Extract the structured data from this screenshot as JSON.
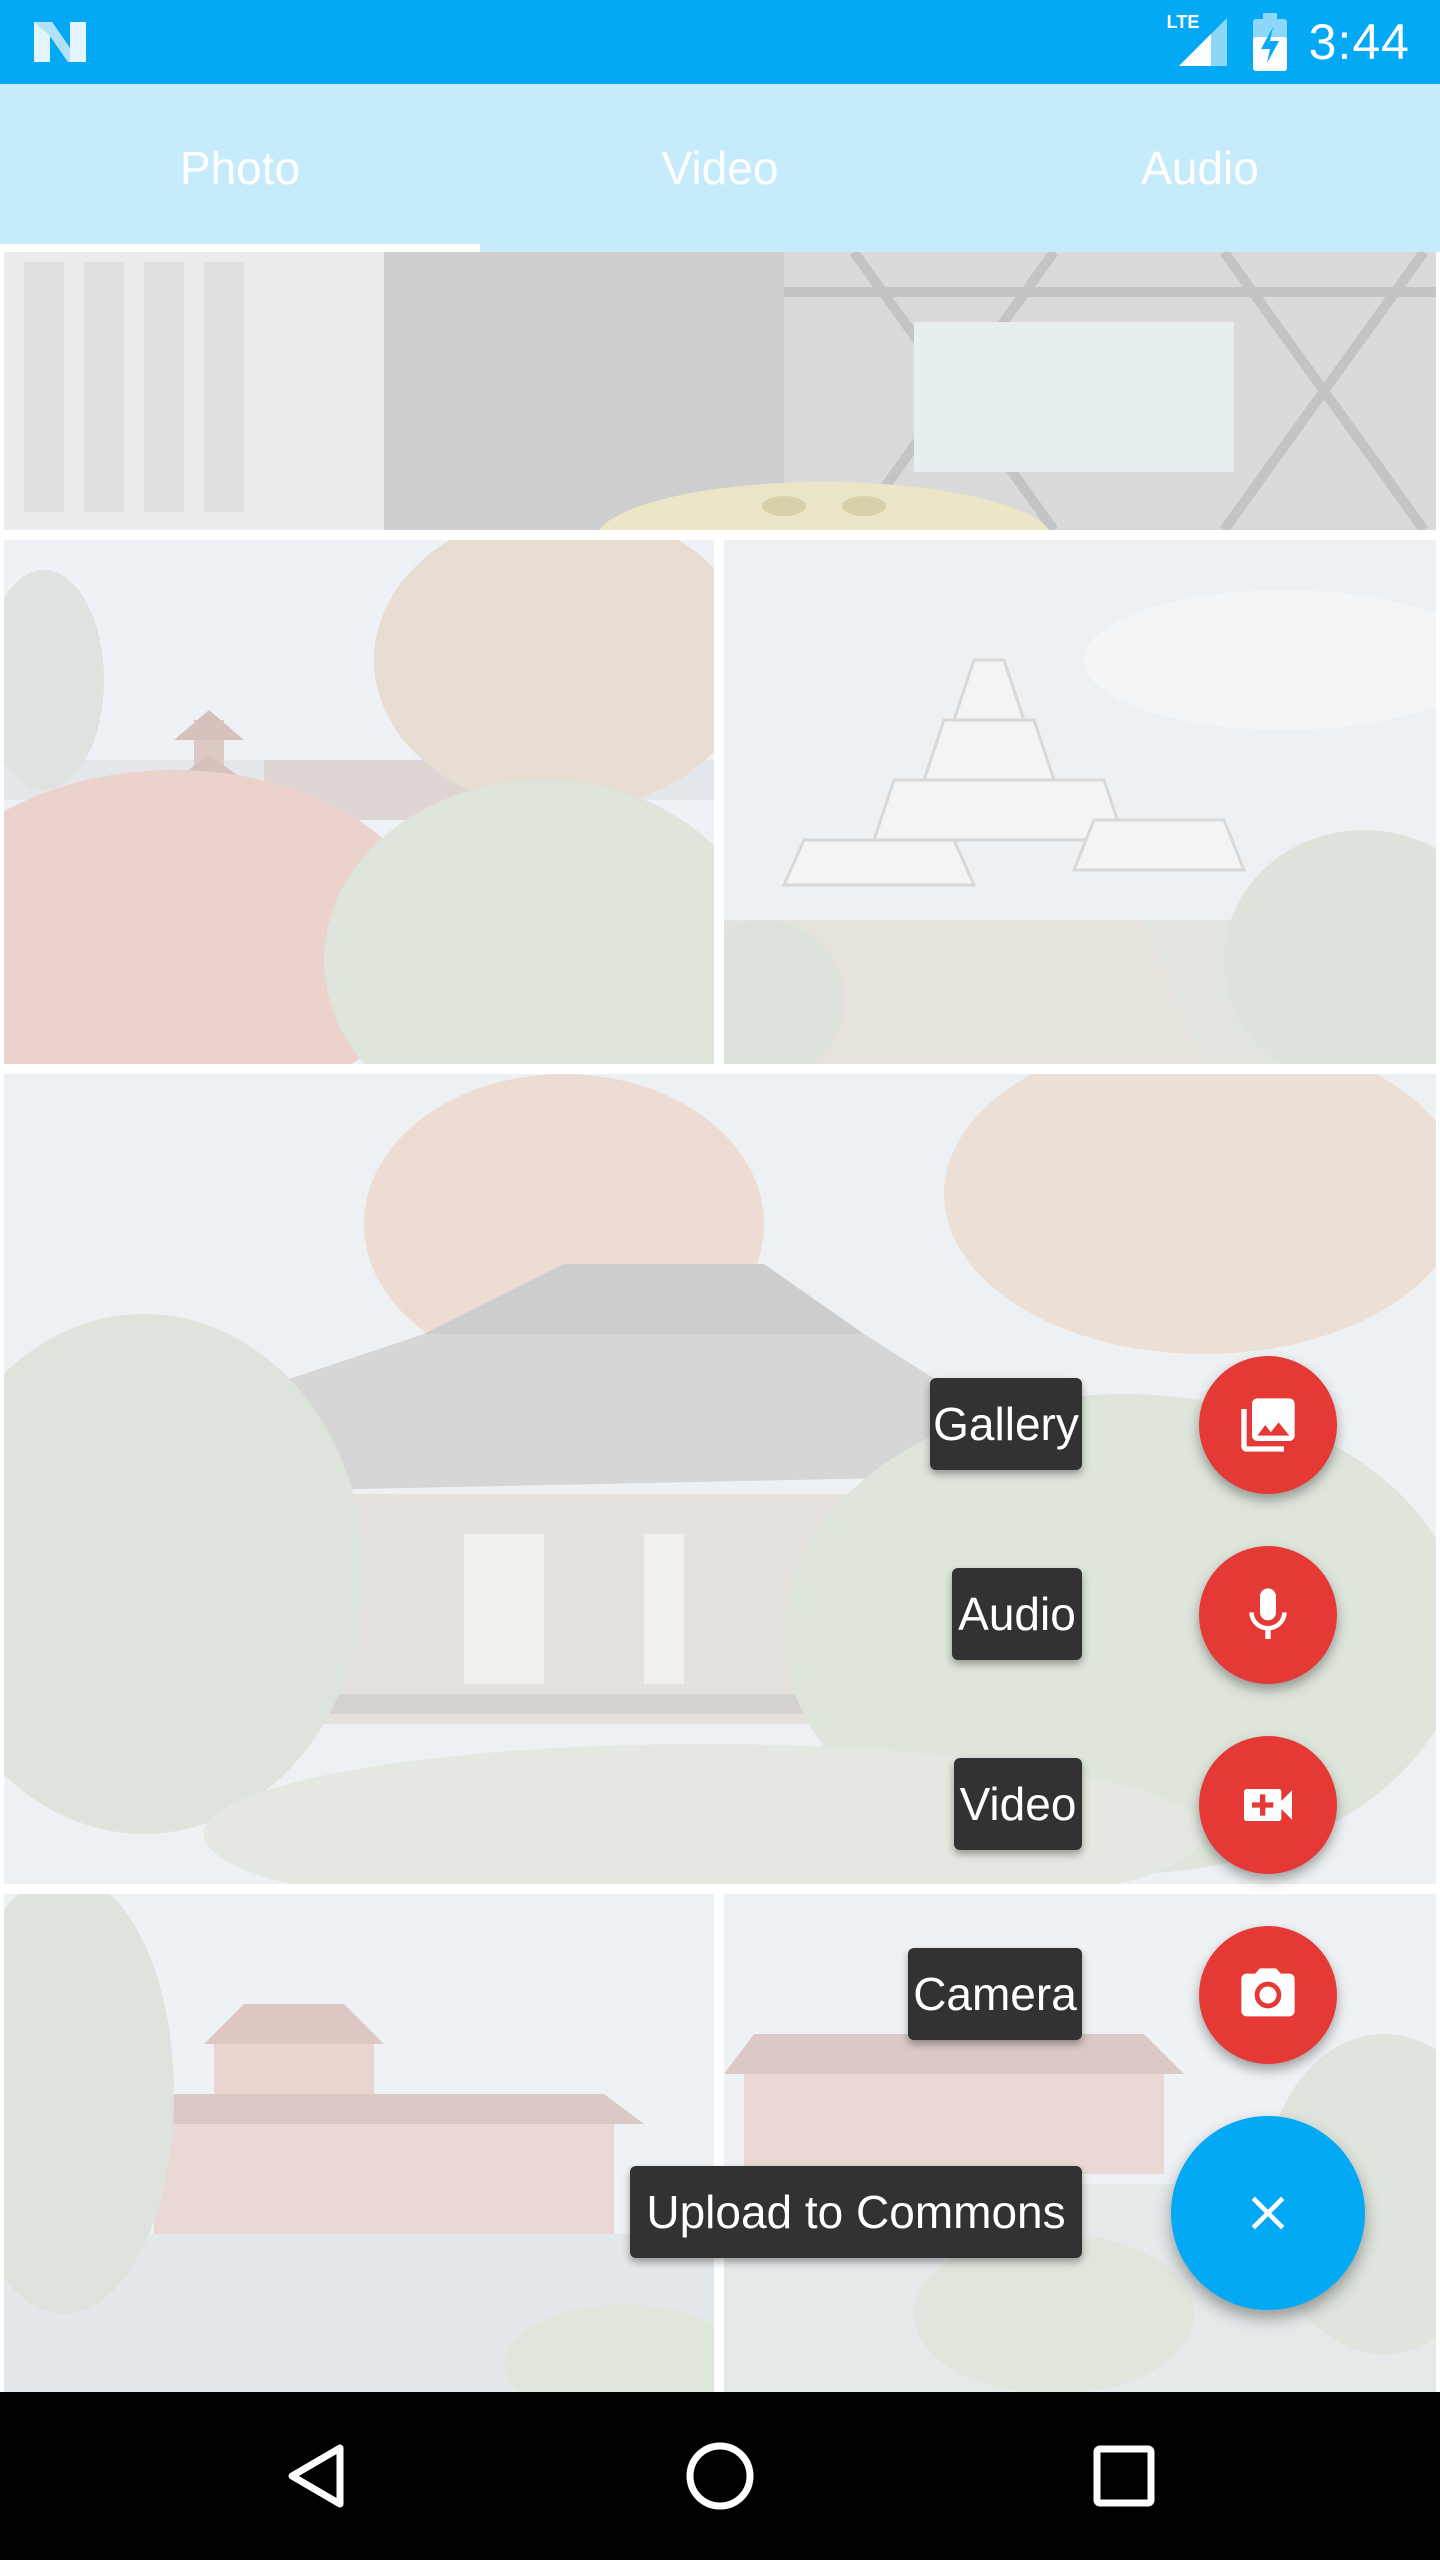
{
  "status_bar": {
    "network": "LTE",
    "time": "3:44"
  },
  "tabs": [
    {
      "label": "Photo",
      "selected": true
    },
    {
      "label": "Video",
      "selected": false
    },
    {
      "label": "Audio",
      "selected": false
    }
  ],
  "photos": [
    {
      "name": "station-interior-photo"
    },
    {
      "name": "pagoda-autumn-photo"
    },
    {
      "name": "castle-photo"
    },
    {
      "name": "temple-garden-photo"
    },
    {
      "name": "phoenix-hall-left-photo"
    },
    {
      "name": "phoenix-hall-right-photo"
    }
  ],
  "fab_menu": {
    "gallery_label": "Gallery",
    "audio_label": "Audio",
    "video_label": "Video",
    "camera_label": "Camera",
    "upload_label": "Upload to Commons",
    "icons": [
      "gallery-icon",
      "microphone-icon",
      "video-camera-icon",
      "camera-icon",
      "close-icon"
    ],
    "mini_fab_color": "#e53935",
    "main_fab_color": "#03a9f4"
  },
  "colors": {
    "status_bar": "#03a9f4",
    "tab_bar": "#c6ecfb"
  },
  "nav_bar": {
    "icons": [
      "back-icon",
      "home-icon",
      "recents-icon"
    ]
  }
}
